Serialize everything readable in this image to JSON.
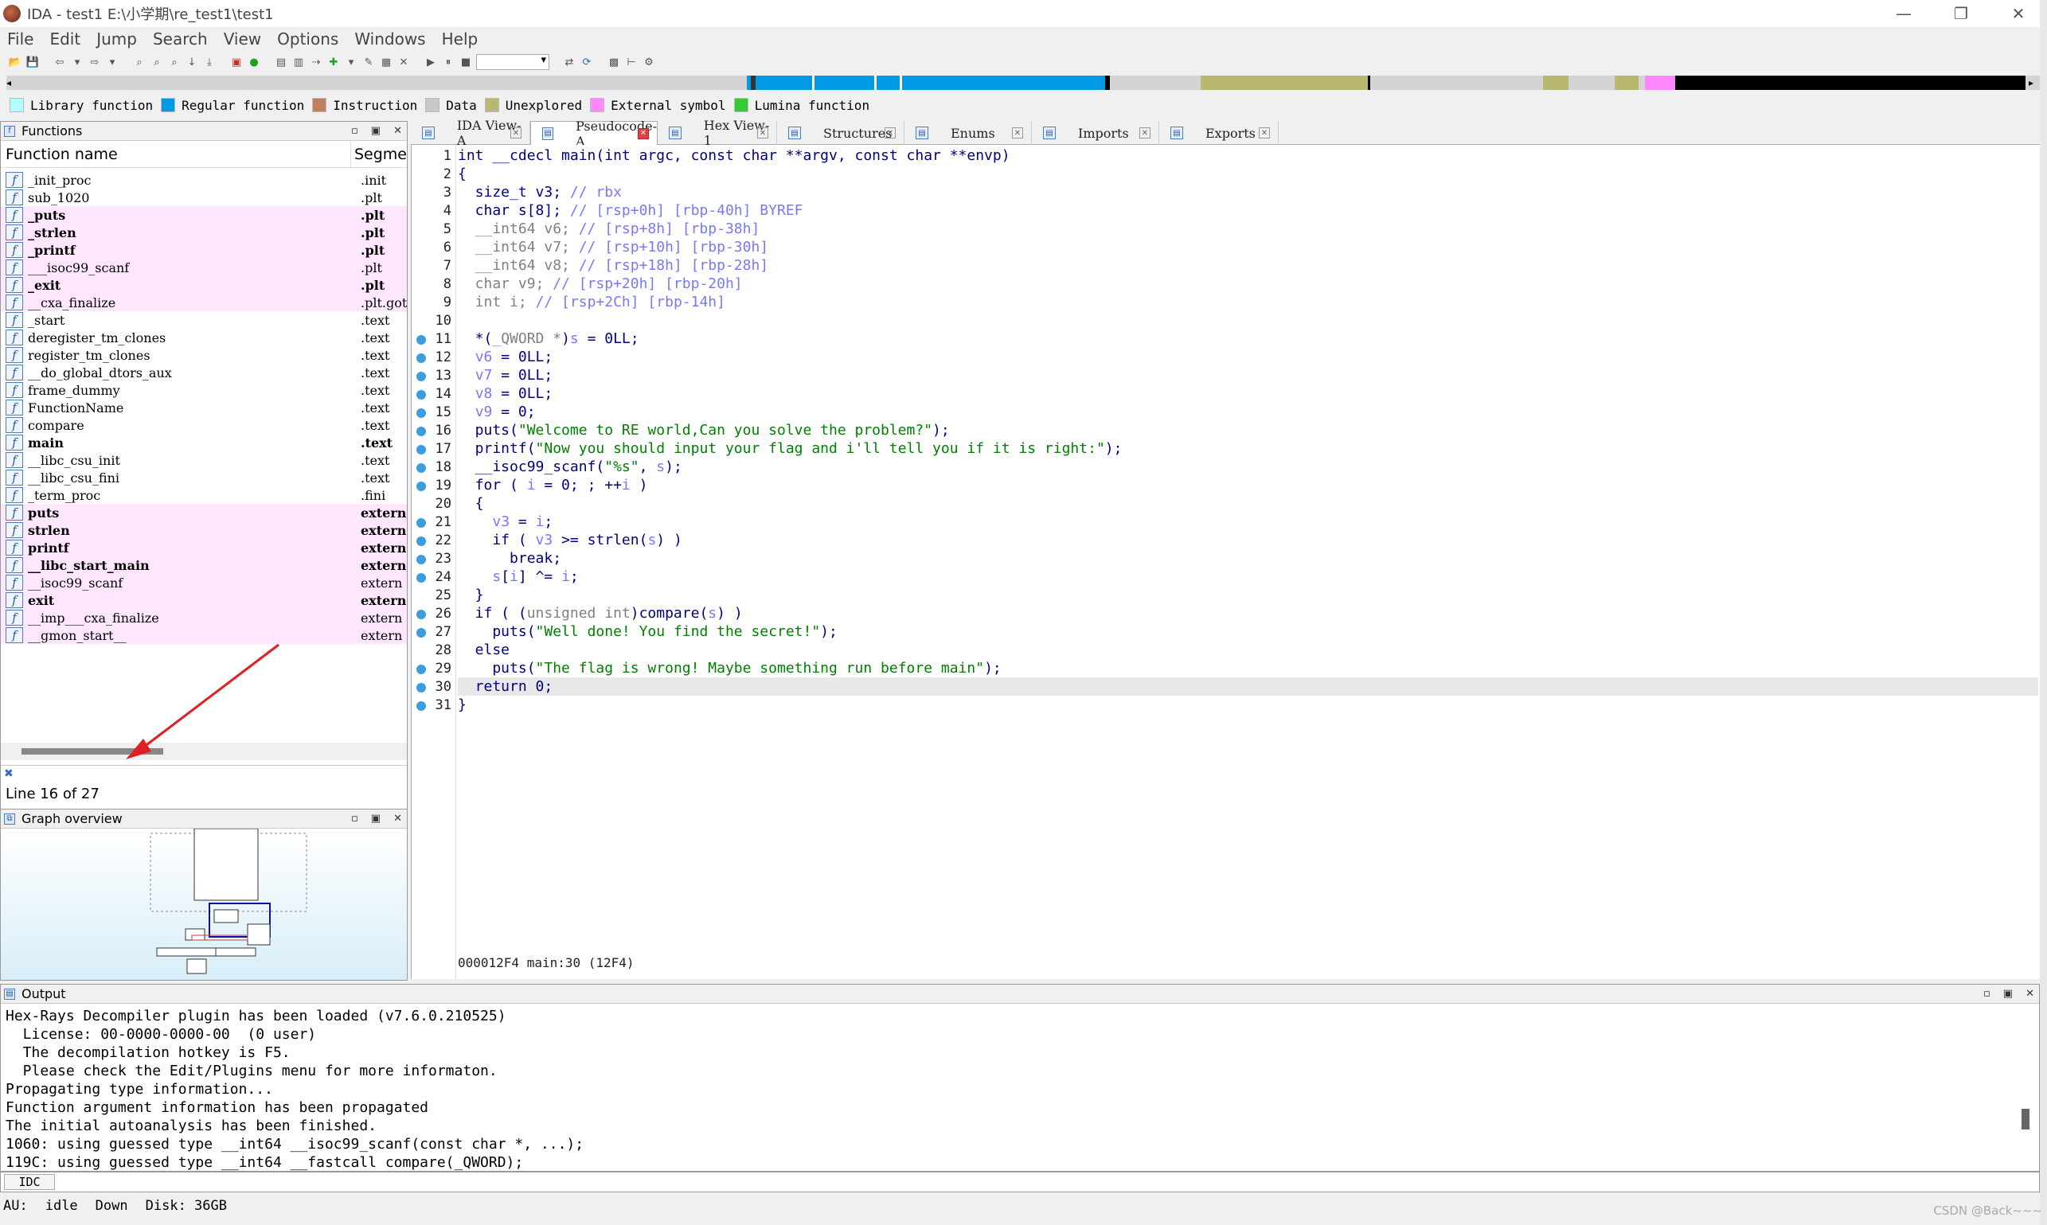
{
  "window": {
    "title": "IDA - test1 E:\\小学期\\re_test1\\test1",
    "controls": [
      "—",
      "❐",
      "✕"
    ]
  },
  "menu": [
    "File",
    "Edit",
    "Jump",
    "Search",
    "View",
    "Options",
    "Windows",
    "Help"
  ],
  "legend": [
    {
      "label": "Library function",
      "color": "#b0ffff"
    },
    {
      "label": "Regular function",
      "color": "#0099e6"
    },
    {
      "label": "Instruction",
      "color": "#c08060"
    },
    {
      "label": "Data",
      "color": "#c8c8c8"
    },
    {
      "label": "Unexplored",
      "color": "#b8b870"
    },
    {
      "label": "External symbol",
      "color": "#ff88ff"
    },
    {
      "label": "Lumina function",
      "color": "#33cc33"
    }
  ],
  "functions_panel": {
    "title": "Functions",
    "col_name": "Function name",
    "col_segment": "Segme",
    "rows": [
      {
        "name": "_init_proc",
        "seg": ".init",
        "pink": false,
        "bold": false
      },
      {
        "name": "sub_1020",
        "seg": ".plt",
        "pink": false,
        "bold": false
      },
      {
        "name": "_puts",
        "seg": ".plt",
        "pink": true,
        "bold": true
      },
      {
        "name": "_strlen",
        "seg": ".plt",
        "pink": true,
        "bold": true
      },
      {
        "name": "_printf",
        "seg": ".plt",
        "pink": true,
        "bold": true
      },
      {
        "name": "___isoc99_scanf",
        "seg": ".plt",
        "pink": true,
        "bold": false
      },
      {
        "name": "_exit",
        "seg": ".plt",
        "pink": true,
        "bold": true
      },
      {
        "name": "__cxa_finalize",
        "seg": ".plt.got",
        "pink": true,
        "bold": false
      },
      {
        "name": "_start",
        "seg": ".text",
        "pink": false,
        "bold": false
      },
      {
        "name": "deregister_tm_clones",
        "seg": ".text",
        "pink": false,
        "bold": false
      },
      {
        "name": "register_tm_clones",
        "seg": ".text",
        "pink": false,
        "bold": false
      },
      {
        "name": "__do_global_dtors_aux",
        "seg": ".text",
        "pink": false,
        "bold": false
      },
      {
        "name": "frame_dummy",
        "seg": ".text",
        "pink": false,
        "bold": false
      },
      {
        "name": "FunctionName",
        "seg": ".text",
        "pink": false,
        "bold": false
      },
      {
        "name": "compare",
        "seg": ".text",
        "pink": false,
        "bold": false
      },
      {
        "name": "main",
        "seg": ".text",
        "pink": false,
        "bold": true
      },
      {
        "name": "__libc_csu_init",
        "seg": ".text",
        "pink": false,
        "bold": false
      },
      {
        "name": "__libc_csu_fini",
        "seg": ".text",
        "pink": false,
        "bold": false
      },
      {
        "name": "_term_proc",
        "seg": ".fini",
        "pink": false,
        "bold": false
      },
      {
        "name": "puts",
        "seg": "extern",
        "pink": true,
        "bold": true
      },
      {
        "name": "strlen",
        "seg": "extern",
        "pink": true,
        "bold": true
      },
      {
        "name": "printf",
        "seg": "extern",
        "pink": true,
        "bold": true
      },
      {
        "name": "__libc_start_main",
        "seg": "extern",
        "pink": true,
        "bold": true
      },
      {
        "name": "__isoc99_scanf",
        "seg": "extern",
        "pink": true,
        "bold": false
      },
      {
        "name": "exit",
        "seg": "extern",
        "pink": true,
        "bold": true
      },
      {
        "name": "__imp___cxa_finalize",
        "seg": "extern",
        "pink": true,
        "bold": false
      },
      {
        "name": "__gmon_start__",
        "seg": "extern",
        "pink": true,
        "bold": false
      }
    ],
    "status": "Line 16 of 27"
  },
  "graph_panel": {
    "title": "Graph overview"
  },
  "tabs": [
    {
      "label": "IDA View-A",
      "active": false
    },
    {
      "label": "Pseudocode-A",
      "active": true
    },
    {
      "label": "Hex View-1",
      "active": false
    },
    {
      "label": "Structures",
      "active": false
    },
    {
      "label": "Enums",
      "active": false
    },
    {
      "label": "Imports",
      "active": false
    },
    {
      "label": "Exports",
      "active": false
    }
  ],
  "code": {
    "lines": [
      {
        "n": "1",
        "bp": false,
        "parts": [
          [
            "int __cdecl main(int argc, const char **argv, const char **envp)",
            ""
          ]
        ]
      },
      {
        "n": "2",
        "bp": false,
        "parts": [
          [
            "{",
            ""
          ]
        ]
      },
      {
        "n": "3",
        "bp": false,
        "parts": [
          [
            "  size_t v3; ",
            ""
          ],
          [
            "// rbx",
            "cm"
          ]
        ]
      },
      {
        "n": "4",
        "bp": false,
        "parts": [
          [
            "  char s[8]; ",
            ""
          ],
          [
            "// [rsp+0h] [rbp-40h] BYREF",
            "cm"
          ]
        ]
      },
      {
        "n": "5",
        "bp": false,
        "parts": [
          [
            "  __int64 v6; ",
            "gr"
          ],
          [
            "// [rsp+8h] [rbp-38h]",
            "cm"
          ]
        ]
      },
      {
        "n": "6",
        "bp": false,
        "parts": [
          [
            "  __int64 v7; ",
            "gr"
          ],
          [
            "// [rsp+10h] [rbp-30h]",
            "cm"
          ]
        ]
      },
      {
        "n": "7",
        "bp": false,
        "parts": [
          [
            "  __int64 v8; ",
            "gr"
          ],
          [
            "// [rsp+18h] [rbp-28h]",
            "cm"
          ]
        ]
      },
      {
        "n": "8",
        "bp": false,
        "parts": [
          [
            "  char v9; ",
            "gr"
          ],
          [
            "// [rsp+20h] [rbp-20h]",
            "cm"
          ]
        ]
      },
      {
        "n": "9",
        "bp": false,
        "parts": [
          [
            "  int i; ",
            "gr"
          ],
          [
            "// [rsp+2Ch] [rbp-14h]",
            "cm"
          ]
        ]
      },
      {
        "n": "10",
        "bp": false,
        "parts": [
          [
            "",
            ""
          ]
        ]
      },
      {
        "n": "11",
        "bp": true,
        "parts": [
          [
            "  *(",
            ""
          ],
          [
            "_QWORD *",
            "gr"
          ],
          [
            ")",
            ""
          ],
          [
            "s",
            "cm"
          ],
          [
            " = 0LL;",
            ""
          ]
        ]
      },
      {
        "n": "12",
        "bp": true,
        "parts": [
          [
            "  ",
            ""
          ],
          [
            "v6",
            "cm"
          ],
          [
            " = 0LL;",
            ""
          ]
        ]
      },
      {
        "n": "13",
        "bp": true,
        "parts": [
          [
            "  ",
            ""
          ],
          [
            "v7",
            "cm"
          ],
          [
            " = 0LL;",
            ""
          ]
        ]
      },
      {
        "n": "14",
        "bp": true,
        "parts": [
          [
            "  ",
            ""
          ],
          [
            "v8",
            "cm"
          ],
          [
            " = 0LL;",
            ""
          ]
        ]
      },
      {
        "n": "15",
        "bp": true,
        "parts": [
          [
            "  ",
            ""
          ],
          [
            "v9",
            "cm"
          ],
          [
            " = 0;",
            ""
          ]
        ]
      },
      {
        "n": "16",
        "bp": true,
        "parts": [
          [
            "  puts(",
            ""
          ],
          [
            "\"Welcome to RE world,Can you solve the problem?\"",
            "str"
          ],
          [
            ");",
            ""
          ]
        ]
      },
      {
        "n": "17",
        "bp": true,
        "parts": [
          [
            "  printf(",
            ""
          ],
          [
            "\"Now you should input your flag and i'll tell you if it is right:\"",
            "str"
          ],
          [
            ");",
            ""
          ]
        ]
      },
      {
        "n": "18",
        "bp": true,
        "parts": [
          [
            "  __isoc99_scanf(",
            ""
          ],
          [
            "\"%s\"",
            "str"
          ],
          [
            ", ",
            ""
          ],
          [
            "s",
            "cm"
          ],
          [
            ");",
            ""
          ]
        ]
      },
      {
        "n": "19",
        "bp": true,
        "parts": [
          [
            "  for ( ",
            ""
          ],
          [
            "i",
            "cm"
          ],
          [
            " = 0; ; ++",
            ""
          ],
          [
            "i",
            "cm"
          ],
          [
            " )",
            ""
          ]
        ]
      },
      {
        "n": "20",
        "bp": false,
        "parts": [
          [
            "  {",
            ""
          ]
        ]
      },
      {
        "n": "21",
        "bp": true,
        "parts": [
          [
            "    ",
            ""
          ],
          [
            "v3",
            "cm"
          ],
          [
            " = ",
            ""
          ],
          [
            "i",
            "cm"
          ],
          [
            ";",
            ""
          ]
        ]
      },
      {
        "n": "22",
        "bp": true,
        "parts": [
          [
            "    if ( ",
            ""
          ],
          [
            "v3",
            "cm"
          ],
          [
            " >= strlen(",
            ""
          ],
          [
            "s",
            "cm"
          ],
          [
            ") )",
            ""
          ]
        ]
      },
      {
        "n": "23",
        "bp": true,
        "parts": [
          [
            "      break;",
            ""
          ]
        ]
      },
      {
        "n": "24",
        "bp": true,
        "parts": [
          [
            "    ",
            ""
          ],
          [
            "s",
            "cm"
          ],
          [
            "[",
            ""
          ],
          [
            "i",
            "cm"
          ],
          [
            "] ^= ",
            ""
          ],
          [
            "i",
            "cm"
          ],
          [
            ";",
            ""
          ]
        ]
      },
      {
        "n": "25",
        "bp": false,
        "parts": [
          [
            "  }",
            ""
          ]
        ]
      },
      {
        "n": "26",
        "bp": true,
        "parts": [
          [
            "  if ( (",
            ""
          ],
          [
            "unsigned int",
            "gr"
          ],
          [
            ")compare(",
            ""
          ],
          [
            "s",
            "cm"
          ],
          [
            ") )",
            ""
          ]
        ]
      },
      {
        "n": "27",
        "bp": true,
        "parts": [
          [
            "    puts(",
            ""
          ],
          [
            "\"Well done! You find the secret!\"",
            "str"
          ],
          [
            ");",
            ""
          ]
        ]
      },
      {
        "n": "28",
        "bp": false,
        "parts": [
          [
            "  else",
            ""
          ]
        ]
      },
      {
        "n": "29",
        "bp": true,
        "parts": [
          [
            "    puts(",
            ""
          ],
          [
            "\"The flag is wrong! Maybe something run before main\"",
            "str"
          ],
          [
            ");",
            ""
          ]
        ]
      },
      {
        "n": "30",
        "bp": true,
        "parts": [
          [
            "  return 0;",
            ""
          ]
        ],
        "hl": true
      },
      {
        "n": "31",
        "bp": true,
        "parts": [
          [
            "}",
            ""
          ]
        ]
      }
    ],
    "status": "000012F4 main:30 (12F4)"
  },
  "output": {
    "title": "Output",
    "lines": [
      "Hex-Rays Decompiler plugin has been loaded (v7.6.0.210525)",
      "  License: 00-0000-0000-00  (0 user)",
      "  The decompilation hotkey is F5.",
      "  Please check the Edit/Plugins menu for more informaton.",
      "Propagating type information...",
      "Function argument information has been propagated",
      "The initial autoanalysis has been finished.",
      "1060: using guessed type __int64 __isoc99_scanf(const char *, ...);",
      "119C: using guessed type __int64 __fastcall compare(_QWORD);"
    ],
    "idc_label": "IDC"
  },
  "status": {
    "au_label": "AU:",
    "au_state": "idle",
    "direction": "Down",
    "disk": "Disk: 36GB"
  },
  "watermark": "CSDN @Back~~~"
}
